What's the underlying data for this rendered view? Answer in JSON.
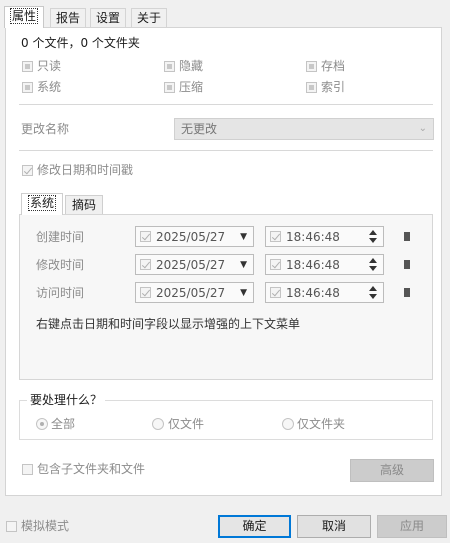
{
  "tabs": [
    {
      "label": "属性",
      "active": true
    },
    {
      "label": "报告",
      "active": false
    },
    {
      "label": "设置",
      "active": false
    },
    {
      "label": "关于",
      "active": false
    }
  ],
  "summary": "0 个文件，0 个文件夹",
  "attributes": {
    "readonly": "只读",
    "hidden": "隐藏",
    "archive": "存档",
    "system": "系统",
    "compressed": "压缩",
    "index": "索引"
  },
  "rename": {
    "label": "更改名称",
    "value": "无更改"
  },
  "modify_datetime_label": "修改日期和时间戳",
  "subtabs": [
    {
      "label": "系统",
      "active": true
    },
    {
      "label": "摘码",
      "active": false
    }
  ],
  "times": {
    "created": {
      "label": "创建时间",
      "date": "2025/05/27",
      "time": "18:46:48"
    },
    "modified": {
      "label": "修改时间",
      "date": "2025/05/27",
      "time": "18:46:48"
    },
    "accessed": {
      "label": "访问时间",
      "date": "2025/05/27",
      "time": "18:46:48"
    }
  },
  "hint": "右键点击日期和时间字段以显示增强的上下文菜单",
  "process": {
    "title": "要处理什么？",
    "options": [
      "全部",
      "仅文件",
      "仅文件夹"
    ],
    "selected": "全部"
  },
  "include_subfolders_label": "包含子文件夹和文件",
  "advanced_button": "高级",
  "simulate_label": "模拟模式",
  "ok_button": "确定",
  "cancel_button": "取消",
  "apply_button": "应用"
}
